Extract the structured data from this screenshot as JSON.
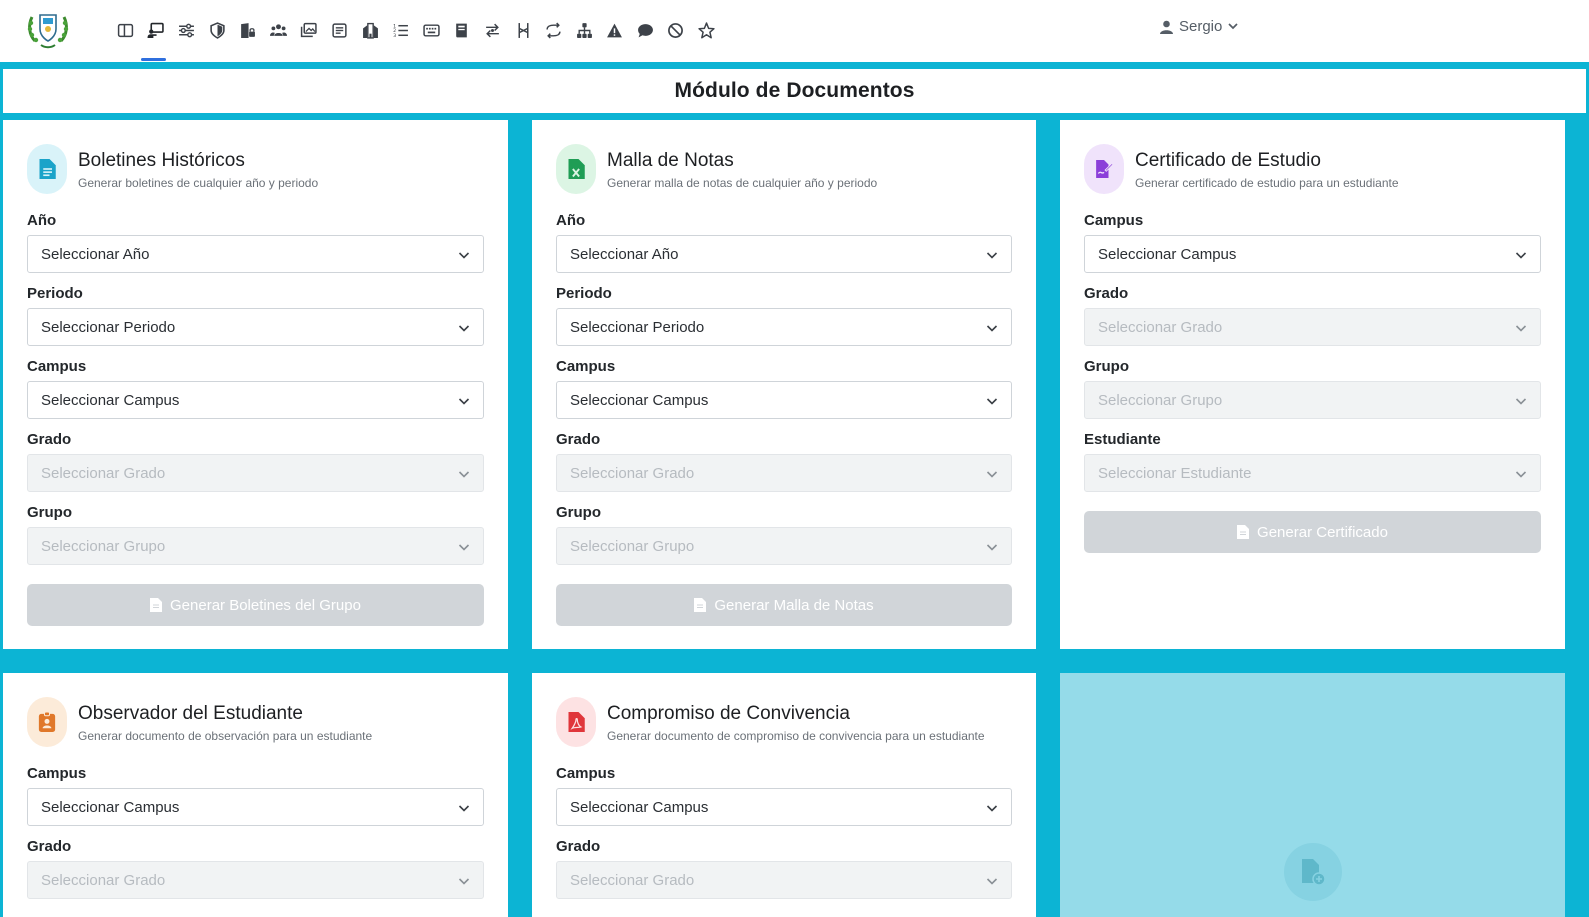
{
  "user": {
    "name": "Sergio"
  },
  "page": {
    "title": "Módulo de Documentos"
  },
  "nav": {
    "icons": [
      "layout-icon",
      "teacher-board-icon",
      "sliders-icon",
      "shield-icon",
      "building-lock-icon",
      "users-icon",
      "gallery-icon",
      "id-card-icon",
      "hotel-icon",
      "list-ordered-icon",
      "keyboard-icon",
      "book-icon",
      "arrows-exchange-icon",
      "git-branch-icon",
      "repeat-arrows-icon",
      "hierarchy-icon",
      "warning-icon",
      "chat-icon",
      "block-icon",
      "star-icon"
    ],
    "active_index": 1
  },
  "cards": {
    "boletines": {
      "title": "Boletines Históricos",
      "subtitle": "Generar boletines de cualquier año y periodo",
      "fields": [
        {
          "label": "Año",
          "placeholder": "Seleccionar Año"
        },
        {
          "label": "Periodo",
          "placeholder": "Seleccionar Periodo"
        },
        {
          "label": "Campus",
          "placeholder": "Seleccionar Campus"
        },
        {
          "label": "Grado",
          "placeholder": "Seleccionar Grado"
        },
        {
          "label": "Grupo",
          "placeholder": "Seleccionar Grupo"
        }
      ],
      "button": "Generar Boletines del Grupo"
    },
    "malla": {
      "title": "Malla de Notas",
      "subtitle": "Generar malla de notas de cualquier año y periodo",
      "fields": [
        {
          "label": "Año",
          "placeholder": "Seleccionar Año"
        },
        {
          "label": "Periodo",
          "placeholder": "Seleccionar Periodo"
        },
        {
          "label": "Campus",
          "placeholder": "Seleccionar Campus"
        },
        {
          "label": "Grado",
          "placeholder": "Seleccionar Grado"
        },
        {
          "label": "Grupo",
          "placeholder": "Seleccionar Grupo"
        }
      ],
      "button": "Generar Malla de Notas"
    },
    "certificado": {
      "title": "Certificado de Estudio",
      "subtitle": "Generar certificado de estudio para un estudiante",
      "fields": [
        {
          "label": "Campus",
          "placeholder": "Seleccionar Campus"
        },
        {
          "label": "Grado",
          "placeholder": "Seleccionar Grado"
        },
        {
          "label": "Grupo",
          "placeholder": "Seleccionar Grupo"
        },
        {
          "label": "Estudiante",
          "placeholder": "Seleccionar Estudiante"
        }
      ],
      "button": "Generar Certificado"
    },
    "observador": {
      "title": "Observador del Estudiante",
      "subtitle": "Generar documento de observación para un estudiante",
      "fields": [
        {
          "label": "Campus",
          "placeholder": "Seleccionar Campus"
        },
        {
          "label": "Grado",
          "placeholder": "Seleccionar Grado"
        }
      ]
    },
    "compromiso": {
      "title": "Compromiso de Convivencia",
      "subtitle": "Generar documento de compromiso de convivencia para un estudiante",
      "fields": [
        {
          "label": "Campus",
          "placeholder": "Seleccionar Campus"
        },
        {
          "label": "Grado",
          "placeholder": "Seleccionar Grado"
        }
      ]
    }
  },
  "colors": {
    "background": "#0cb4d4",
    "boletines_icon": "#1aa3c9",
    "malla_icon": "#1f9d55",
    "certificado_icon": "#8b3fd9",
    "observador_icon": "#e0782a",
    "compromiso_icon": "#e0363b",
    "disabled_button": "#d1d5d9"
  }
}
